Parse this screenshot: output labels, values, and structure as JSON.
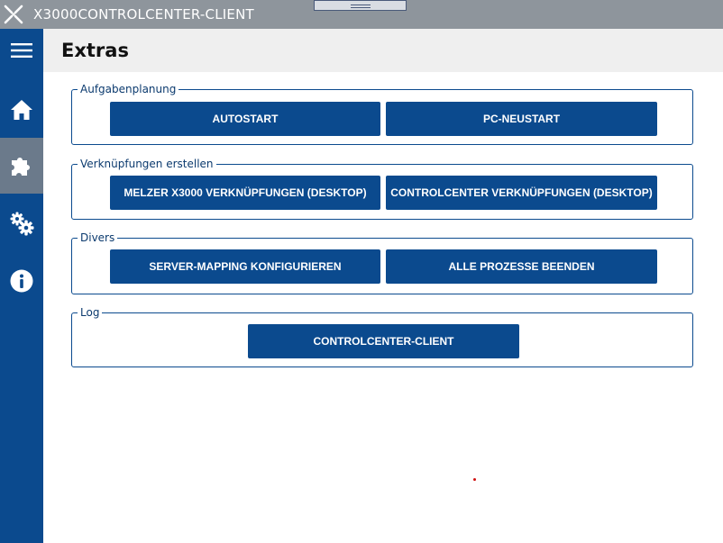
{
  "app": {
    "title": "X3000CONTROLCENTER-CLIENT",
    "accent": "#0b4a8e"
  },
  "sidebar": {
    "items": [
      {
        "icon": "menu-icon"
      },
      {
        "icon": "home-icon"
      },
      {
        "icon": "puzzle-icon",
        "active": true
      },
      {
        "icon": "settings-icon"
      },
      {
        "icon": "info-icon"
      }
    ]
  },
  "header": {
    "title": "Extras"
  },
  "groups": [
    {
      "label": "Aufgabenplanung",
      "buttons": [
        "AUTOSTART",
        "PC-NEUSTART"
      ]
    },
    {
      "label": "Verknüpfungen erstellen",
      "buttons": [
        "MELZER X3000 VERKNÜPFUNGEN (DESKTOP)",
        "CONTROLCENTER VERKNÜPFUNGEN (DESKTOP)"
      ]
    },
    {
      "label": "Divers",
      "buttons": [
        "SERVER-MAPPING KONFIGURIEREN",
        "ALLE PROZESSE BEENDEN"
      ]
    },
    {
      "label": "Log",
      "buttons": [
        "CONTROLCENTER-CLIENT"
      ]
    }
  ]
}
